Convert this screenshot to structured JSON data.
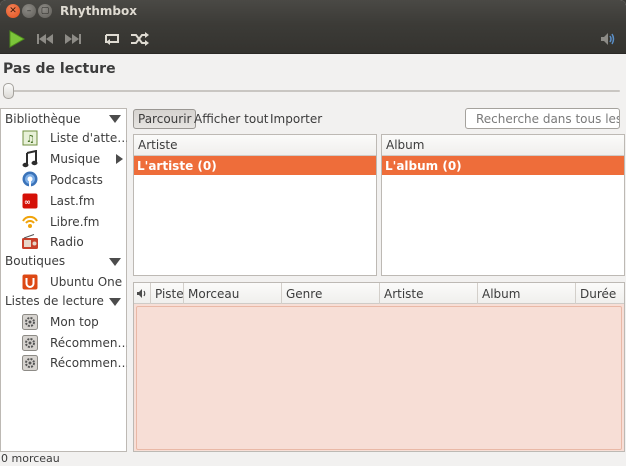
{
  "window": {
    "title": "Rhythmbox"
  },
  "toolbar": {
    "icons": [
      "play-icon",
      "previous-icon",
      "next-icon",
      "repeat-icon",
      "shuffle-icon",
      "volume-icon"
    ]
  },
  "now_playing": {
    "text": "Pas de lecture",
    "progress": 0
  },
  "sidebar": {
    "categories": [
      {
        "label": "Bibliothèque"
      },
      {
        "label": "Boutiques"
      },
      {
        "label": "Listes de lecture"
      }
    ],
    "library": [
      {
        "label": "Liste d'atte…",
        "icon": "queue-icon"
      },
      {
        "label": "Musique",
        "icon": "music-icon"
      },
      {
        "label": "Podcasts",
        "icon": "podcast-icon"
      },
      {
        "label": "Last.fm",
        "icon": "lastfm-icon"
      },
      {
        "label": "Libre.fm",
        "icon": "librefm-icon"
      },
      {
        "label": "Radio",
        "icon": "radio-icon"
      }
    ],
    "stores": [
      {
        "label": "Ubuntu One",
        "icon": "ubuntu-one-icon"
      }
    ],
    "playlists": [
      {
        "label": "Mon top",
        "icon": "gear-icon"
      },
      {
        "label": "Récommen…",
        "icon": "gear-icon"
      },
      {
        "label": "Récommen…",
        "icon": "gear-icon"
      }
    ]
  },
  "browser": {
    "tabs": [
      "Parcourir",
      "Afficher tout",
      "Importer"
    ],
    "active_tab": "Parcourir",
    "search_placeholder": "Recherche dans tous les"
  },
  "artist_pane": {
    "header": "Artiste",
    "row": "L'artiste (0)"
  },
  "album_pane": {
    "header": "Album",
    "row": "L'album (0)"
  },
  "tracklist": {
    "columns": [
      "Piste",
      "Morceau",
      "Genre",
      "Artiste",
      "Album",
      "Durée"
    ]
  },
  "status": {
    "text": "0 morceau"
  },
  "colors": {
    "accent": "#ee6d3a",
    "titlebar": "#3c3b37",
    "window_bg": "#f2f1f0",
    "tracklist_bg": "#f7ded6",
    "play_green": "#7cc43a"
  }
}
